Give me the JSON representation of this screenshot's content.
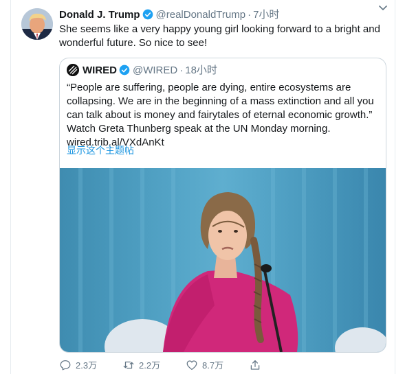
{
  "tweet": {
    "author_name": "Donald J. Trump",
    "author_handle": "@realDonaldTrump",
    "separator": "·",
    "time": "7小时",
    "text": "She seems like a very happy young girl looking forward to a bright and wonderful future. So nice to see!"
  },
  "quoted": {
    "author_name": "WIRED",
    "author_handle": "@WIRED",
    "separator": "·",
    "time": "18小时",
    "text_lines": [
      "“People are suffering, people are dying, entire ecosystems are",
      "collapsing. We are in the beginning of a mass extinction and all you",
      "can talk about is money and fairytales of eternal economic growth.”",
      "Watch Greta Thunberg speak at the UN Monday morning.",
      "wired.trib.al/VXdAnKt"
    ],
    "show_thread_label": "显示这个主题帖"
  },
  "actions": {
    "reply_count": "2.3万",
    "retweet_count": "2.2万",
    "like_count": "8.7万"
  },
  "colors": {
    "link": "#1b95e0",
    "muted": "#657786",
    "verified": "#1da1f2",
    "border": "#ccd6dd"
  },
  "icons": [
    "verified-badge-icon",
    "chevron-down-icon",
    "reply-icon",
    "retweet-icon",
    "like-icon",
    "share-icon"
  ]
}
